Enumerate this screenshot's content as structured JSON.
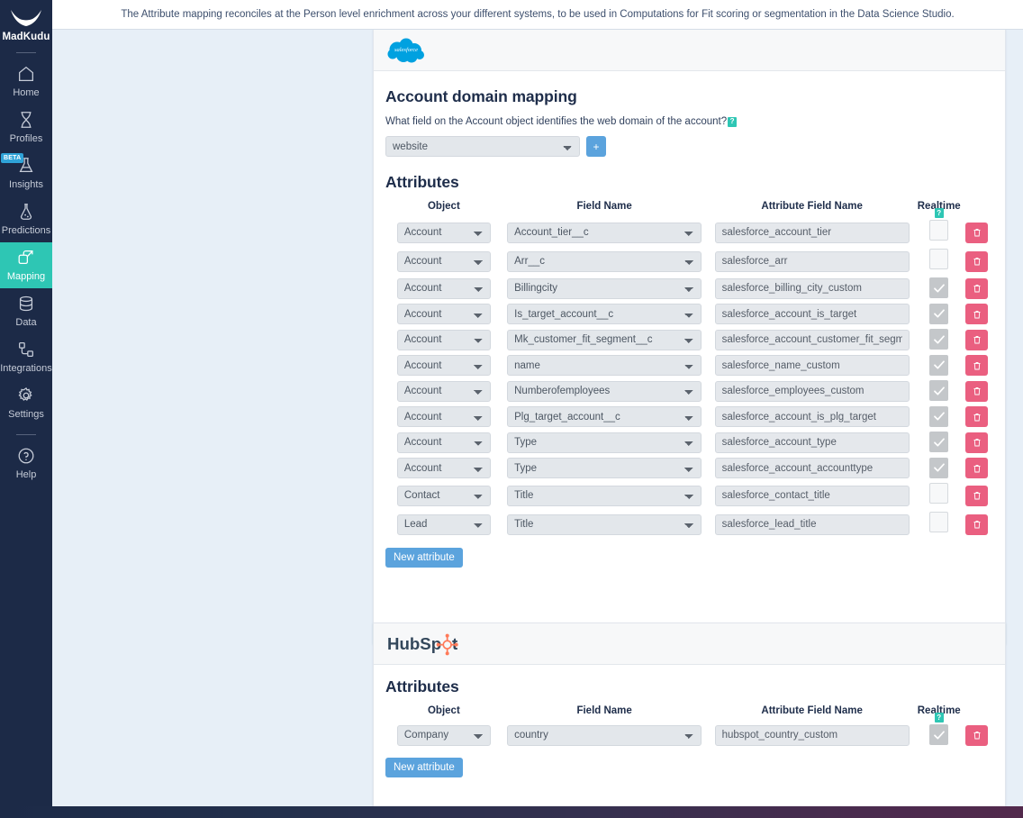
{
  "header": {
    "banner_text": "The Attribute mapping reconciles at the Person level enrichment across your different systems, to be used in Computations for Fit scoring or segmentation in the Data Science Studio."
  },
  "sidebar": {
    "brand": "MadKudu",
    "items": [
      {
        "label": "Home",
        "icon": "home-icon",
        "active": false,
        "badge": ""
      },
      {
        "label": "Profiles",
        "icon": "profiles-icon",
        "active": false,
        "badge": ""
      },
      {
        "label": "Insights",
        "icon": "insights-icon",
        "active": false,
        "badge": "BETA"
      },
      {
        "label": "Predictions",
        "icon": "predictions-icon",
        "active": false,
        "badge": ""
      },
      {
        "label": "Mapping",
        "icon": "mapping-icon",
        "active": true,
        "badge": ""
      },
      {
        "label": "Data",
        "icon": "database-icon",
        "active": false,
        "badge": ""
      },
      {
        "label": "Integrations",
        "icon": "integrations-icon",
        "active": false,
        "badge": ""
      },
      {
        "label": "Settings",
        "icon": "gear-icon",
        "active": false,
        "badge": ""
      },
      {
        "label": "Help",
        "icon": "help-icon",
        "active": false,
        "badge": ""
      }
    ]
  },
  "colors": {
    "sidebar_bg": "#1c2a47",
    "accent_teal": "#2ec6b4",
    "accent_blue": "#5ba3dd",
    "delete_pink": "#ea5f80",
    "page_bg": "#e7eff7"
  },
  "salesforce": {
    "logo_label": "salesforce",
    "domain_mapping": {
      "title": "Account domain mapping",
      "question": "What field on the Account object identifies the web domain of the account?",
      "help_badge": "?",
      "selected_field": "website",
      "options": [
        "website"
      ],
      "add_button": "+"
    },
    "attributes": {
      "title": "Attributes",
      "columns": [
        "Object",
        "Field Name",
        "Attribute Field Name",
        "Realtime"
      ],
      "realtime_help_badge": "?",
      "new_attribute_label": "New attribute",
      "rows": [
        {
          "object": "Account",
          "field": "Account_tier__c",
          "attribute": "salesforce_account_tier",
          "realtime": false
        },
        {
          "object": "Account",
          "field": "Arr__c",
          "attribute": "salesforce_arr",
          "realtime": false
        },
        {
          "object": "Account",
          "field": "Billingcity",
          "attribute": "salesforce_billing_city_custom",
          "realtime": true
        },
        {
          "object": "Account",
          "field": "Is_target_account__c",
          "attribute": "salesforce_account_is_target",
          "realtime": true
        },
        {
          "object": "Account",
          "field": "Mk_customer_fit_segment__c",
          "attribute": "salesforce_account_customer_fit_segment",
          "realtime": true
        },
        {
          "object": "Account",
          "field": "name",
          "attribute": "salesforce_name_custom",
          "realtime": true
        },
        {
          "object": "Account",
          "field": "Numberofemployees",
          "attribute": "salesforce_employees_custom",
          "realtime": true
        },
        {
          "object": "Account",
          "field": "Plg_target_account__c",
          "attribute": "salesforce_account_is_plg_target",
          "realtime": true
        },
        {
          "object": "Account",
          "field": "Type",
          "attribute": "salesforce_account_type",
          "realtime": true
        },
        {
          "object": "Account",
          "field": "Type",
          "attribute": "salesforce_account_accounttype",
          "realtime": true
        },
        {
          "object": "Contact",
          "field": "Title",
          "attribute": "salesforce_contact_title",
          "realtime": false
        },
        {
          "object": "Lead",
          "field": "Title",
          "attribute": "salesforce_lead_title",
          "realtime": false
        }
      ]
    }
  },
  "hubspot": {
    "logo_label": "HubSpot",
    "attributes": {
      "title": "Attributes",
      "columns": [
        "Object",
        "Field Name",
        "Attribute Field Name",
        "Realtime"
      ],
      "realtime_help_badge": "?",
      "new_attribute_label": "New attribute",
      "rows": [
        {
          "object": "Company",
          "field": "country",
          "attribute": "hubspot_country_custom",
          "realtime": true
        }
      ]
    }
  }
}
